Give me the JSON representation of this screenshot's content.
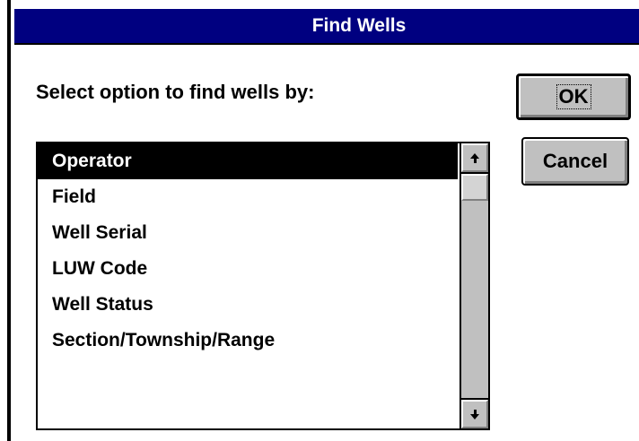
{
  "dialog": {
    "title": "Find Wells",
    "prompt": "Select option to find wells by:"
  },
  "listbox": {
    "selected_index": 0,
    "items": [
      {
        "label": "Operator"
      },
      {
        "label": "Field"
      },
      {
        "label": "Well Serial"
      },
      {
        "label": "LUW Code"
      },
      {
        "label": "Well Status"
      },
      {
        "label": "Section/Township/Range"
      }
    ]
  },
  "buttons": {
    "ok_label": "OK",
    "cancel_label": "Cancel"
  },
  "colors": {
    "titlebar": "#000080",
    "selection": "#000000",
    "button_face": "#c0c0c0"
  },
  "icons": {
    "scroll_up": "arrow-up-icon",
    "scroll_down": "arrow-down-icon"
  }
}
